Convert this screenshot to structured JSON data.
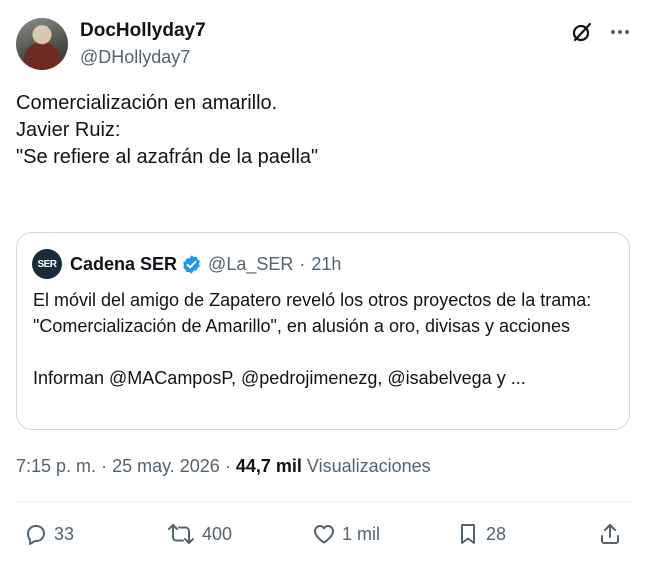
{
  "author": {
    "display_name": "DocHollyday7",
    "handle": "@DHollyday7"
  },
  "tweet": {
    "lines": [
      "Comercialización en amarillo.",
      "",
      "Javier Ruiz:",
      "\"Se refiere al azafrán de la paella\""
    ]
  },
  "quote": {
    "logo_text": "SER",
    "name": "Cadena SER",
    "handle": "@La_SER",
    "time": "21h",
    "text": "El móvil del amigo de Zapatero reveló los otros proyectos de la trama: \"Comercialización de Amarillo\", en alusión a oro, divisas y acciones",
    "mentions": "Informan @MACamposP, @pedrojimenezg, @isabelvega y ..."
  },
  "meta": {
    "time": "7:15 p. m.",
    "date": "25 may. 2026",
    "views_count": "44,7 mil",
    "views_label": "Visualizaciones"
  },
  "actions": {
    "replies": "33",
    "reposts": "400",
    "likes": "1 mil",
    "bookmarks": "28"
  },
  "colors": {
    "text": "#0f1419",
    "secondary": "#536471",
    "border": "#cfd9de",
    "verified": "#1d9bf0"
  },
  "icons": [
    "grok-icon",
    "more-icon",
    "verified-badge-icon",
    "reply-icon",
    "repost-icon",
    "like-icon",
    "bookmark-icon",
    "share-icon"
  ]
}
